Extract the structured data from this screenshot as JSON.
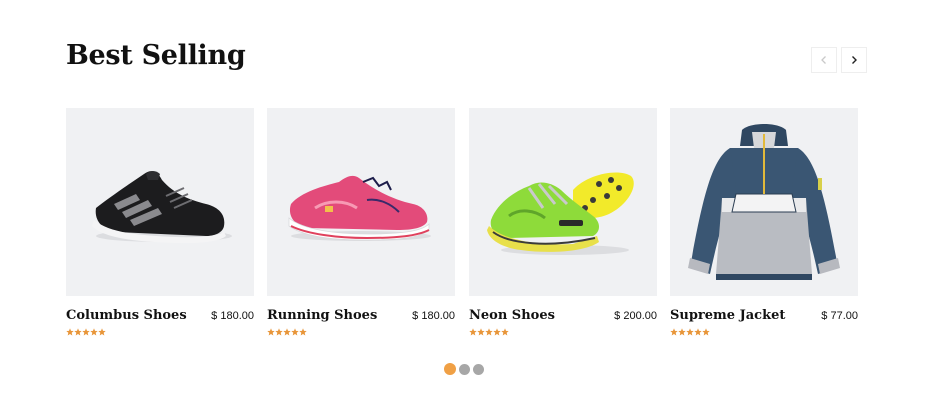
{
  "section": {
    "title": "Best Selling"
  },
  "nav": {
    "prev_icon": "chevron-left-icon",
    "next_icon": "chevron-right-icon"
  },
  "colors": {
    "accent": "#f0a045",
    "star": "#e8963a",
    "card_bg": "#f0f1f3",
    "dot_inactive": "#a7a7a7"
  },
  "products": [
    {
      "name": "Columbus Shoes",
      "price": "$ 180.00",
      "rating": 5,
      "image": "black-sneaker"
    },
    {
      "name": "Running Shoes",
      "price": "$ 180.00",
      "rating": 5,
      "image": "pink-running-shoe"
    },
    {
      "name": "Neon Shoes",
      "price": "$ 200.00",
      "rating": 5,
      "image": "neon-green-shoes"
    },
    {
      "name": "Supreme Jacket",
      "price": "$ 77.00",
      "rating": 5,
      "image": "navy-grey-jacket"
    }
  ],
  "pagination": {
    "pages": 3,
    "active": 1
  }
}
